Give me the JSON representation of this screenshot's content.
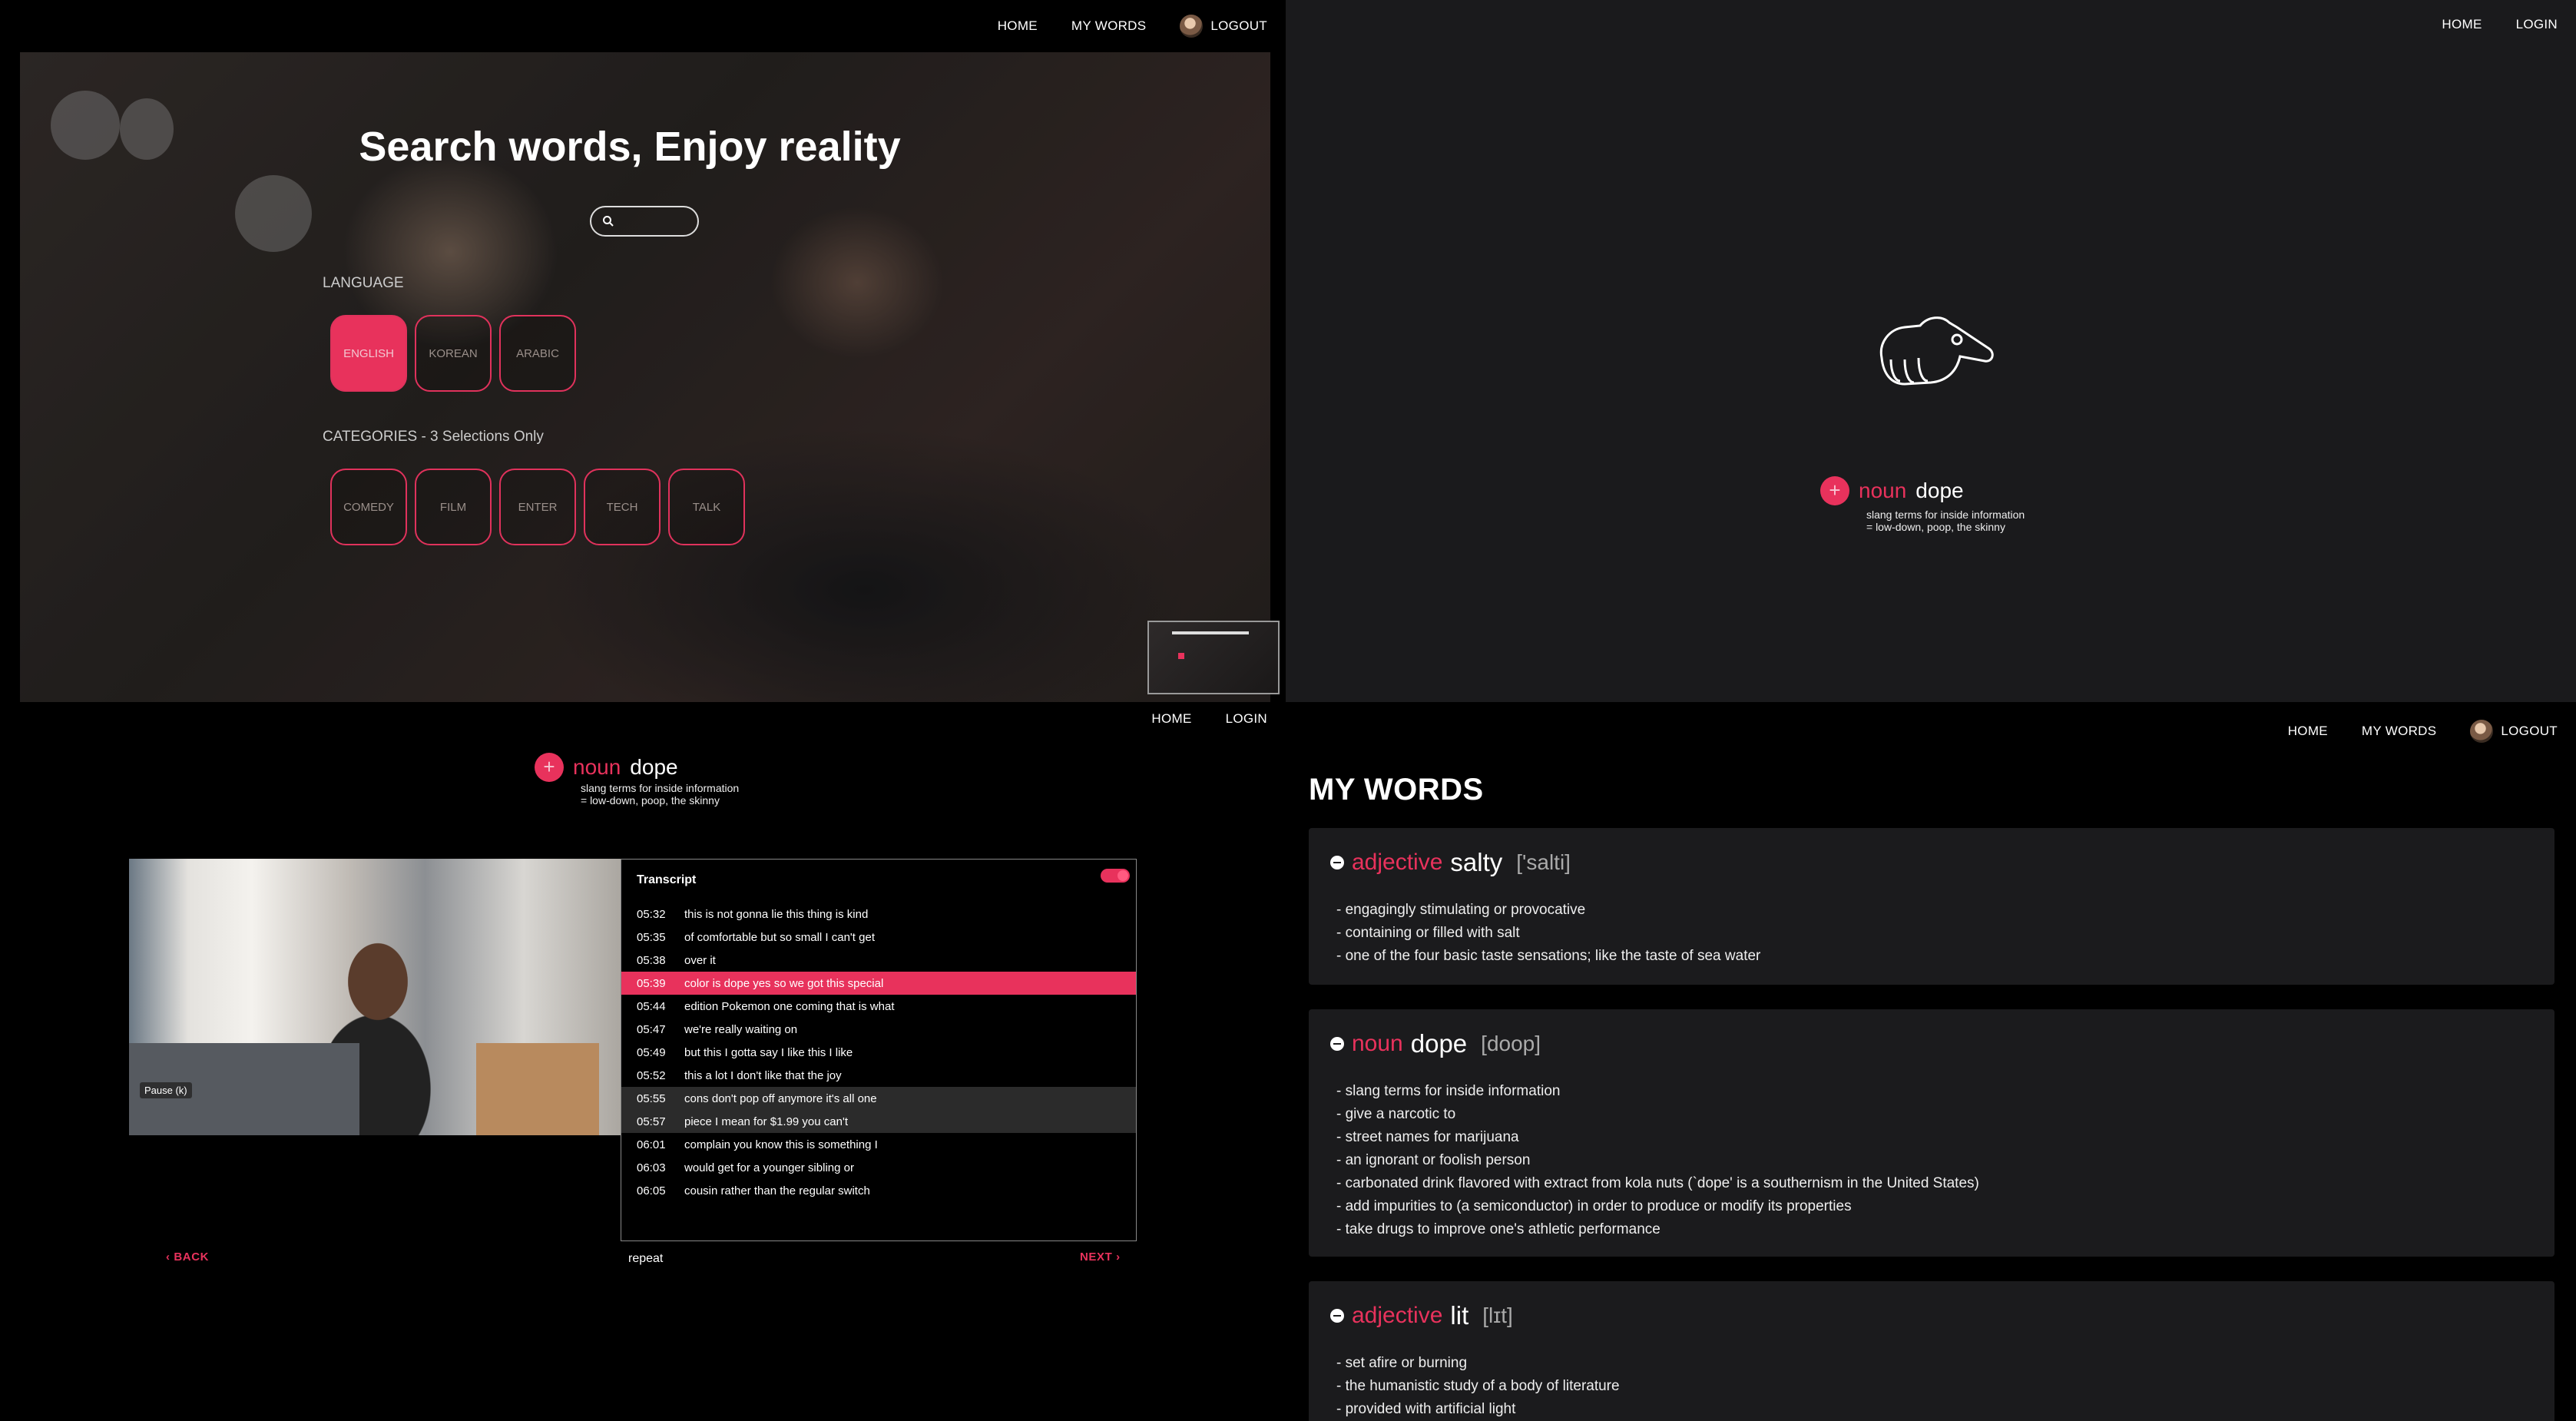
{
  "panel1": {
    "nav": {
      "home": "HOME",
      "my_words": "MY WORDS",
      "logout": "LOGOUT"
    },
    "title": "Search words, Enjoy reality",
    "search": {
      "placeholder": ""
    },
    "language_label": "LANGUAGE",
    "languages": [
      {
        "label": "ENGLISH",
        "active": true
      },
      {
        "label": "KOREAN",
        "active": false
      },
      {
        "label": "ARABIC",
        "active": false
      }
    ],
    "categories_label": "CATEGORIES - 3 Selections Only",
    "categories": [
      "COMEDY",
      "FILM",
      "ENTER",
      "TECH",
      "TALK"
    ]
  },
  "panel2": {
    "nav": {
      "home": "HOME",
      "login": "LOGIN"
    },
    "word": {
      "pos": "noun",
      "word": "dope",
      "def1": "slang terms for inside information",
      "def2": "= low-down, poop, the skinny",
      "plus": "+"
    }
  },
  "panel3": {
    "nav": {
      "home": "HOME",
      "login": "LOGIN"
    },
    "word": {
      "pos": "noun",
      "word": "dope",
      "def1": "slang terms for inside information",
      "def2": "= low-down, poop, the skinny",
      "plus": "+"
    },
    "video": {
      "pause_tooltip": "Pause (k)"
    },
    "transcript": {
      "title": "Transcript",
      "lines": [
        {
          "time": "05:32",
          "text": "this is not gonna lie this thing is kind",
          "state": ""
        },
        {
          "time": "05:35",
          "text": "of comfortable but so small I can't get",
          "state": ""
        },
        {
          "time": "05:38",
          "text": "over it",
          "state": ""
        },
        {
          "time": "05:39",
          "text": "color is dope yes so we got this special",
          "state": "hl"
        },
        {
          "time": "05:44",
          "text": "edition Pokemon one coming that is what",
          "state": ""
        },
        {
          "time": "05:47",
          "text": "we're really waiting on",
          "state": ""
        },
        {
          "time": "05:49",
          "text": "but this I gotta say I like this I like",
          "state": ""
        },
        {
          "time": "05:52",
          "text": "this a lot I don't like that the joy",
          "state": ""
        },
        {
          "time": "05:55",
          "text": "cons don't pop off anymore it's all one",
          "state": "gr"
        },
        {
          "time": "05:57",
          "text": "piece I mean for $1.99 you can't",
          "state": "gr"
        },
        {
          "time": "06:01",
          "text": "complain you know this is something I",
          "state": ""
        },
        {
          "time": "06:03",
          "text": "would get for a younger sibling or",
          "state": ""
        },
        {
          "time": "06:05",
          "text": "cousin rather than the regular switch",
          "state": ""
        }
      ]
    },
    "back": "BACK",
    "repeat": "repeat",
    "next": "NEXT"
  },
  "panel4": {
    "nav": {
      "home": "HOME",
      "my_words": "MY WORDS",
      "logout": "LOGOUT"
    },
    "title": "MY WORDS",
    "cards": [
      {
        "pos": "adjective",
        "word": "salty",
        "pron": "['salti]",
        "defs": [
          "- engagingly stimulating or provocative",
          "- containing or filled with salt",
          "- one of the four basic taste sensations; like the taste of sea water"
        ]
      },
      {
        "pos": "noun",
        "word": "dope",
        "pron": "[doop]",
        "defs": [
          "- slang terms for inside information",
          "- give a narcotic to",
          "- street names for marijuana",
          "- an ignorant or foolish person",
          "- carbonated drink flavored with extract from kola nuts (`dope' is a southernism in the United States)",
          "- add impurities to (a semiconductor) in order to produce or modify its properties",
          "- take drugs to improve one's athletic performance"
        ]
      },
      {
        "pos": "adjective",
        "word": "lit",
        "pron": "[lɪt]",
        "defs": [
          "- set afire or burning",
          "- the humanistic study of a body of literature",
          "- provided with artificial light"
        ]
      }
    ]
  },
  "colors": {
    "accent": "#e8325c",
    "background": "#000000",
    "card": "#1b1b1d"
  }
}
